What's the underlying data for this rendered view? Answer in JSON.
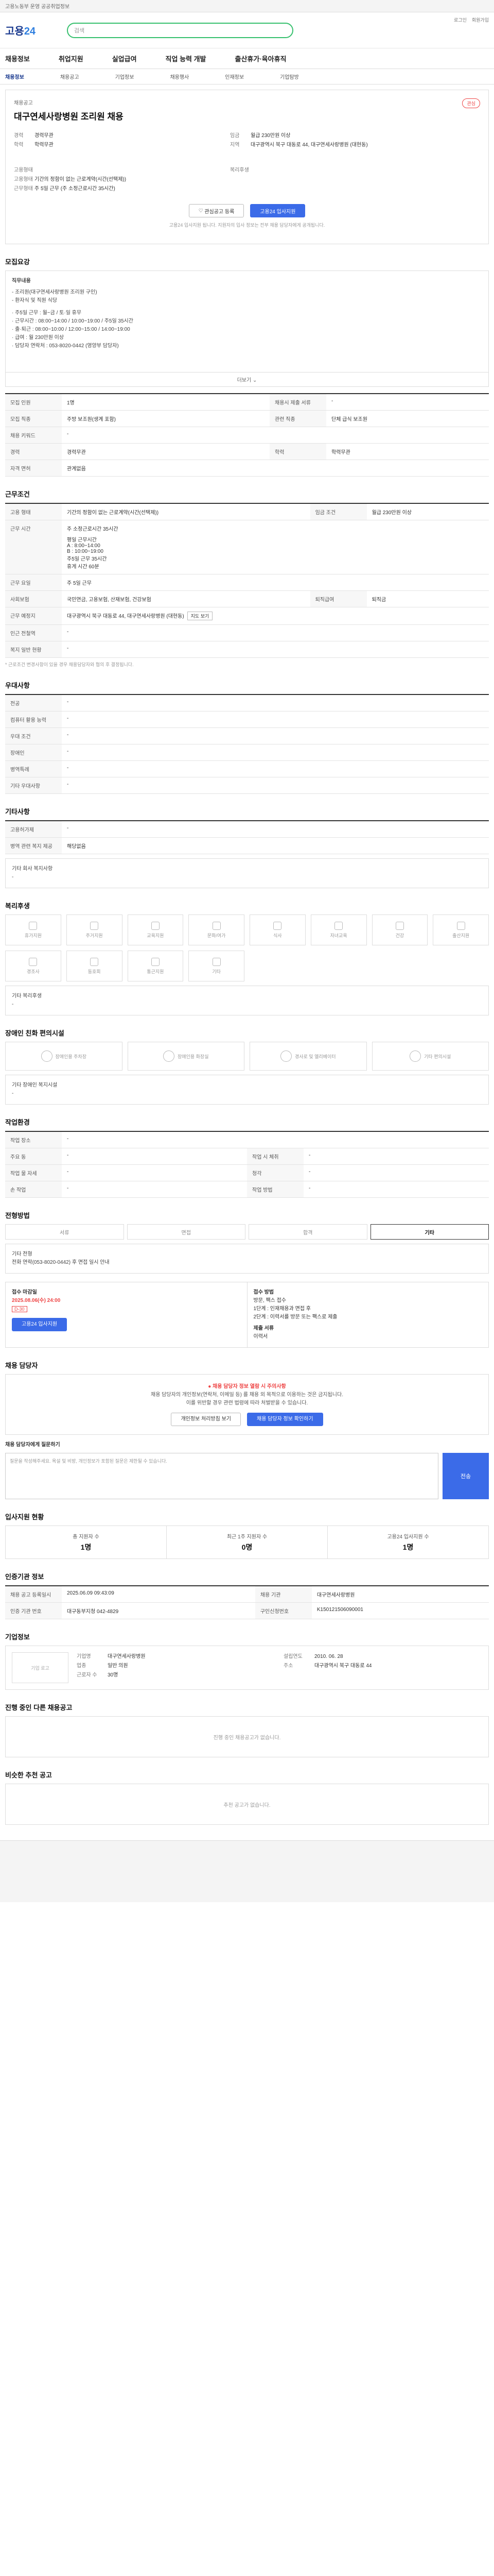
{
  "topbar": {
    "text": "고용노동부 운영 공공취업정보"
  },
  "header": {
    "logo_main": "고용",
    "logo_sub": "24",
    "search_placeholder": "검색",
    "links": [
      "로그인",
      "회원가입"
    ]
  },
  "gnb": [
    "채용정보",
    "취업지원",
    "실업급여",
    "직업 능력 개발",
    "출산휴가·육아휴직"
  ],
  "lnb": [
    "채용정보",
    "채용공고",
    "기업정보",
    "채용행사",
    "인재정보",
    "기업탐방"
  ],
  "hero": {
    "tag": "채용공고",
    "title": "대구연세사랑병원 조리원 채용",
    "star": "관심",
    "left": [
      {
        "k": "경력",
        "v": "경력무관"
      },
      {
        "k": "학력",
        "v": "학력무관"
      }
    ],
    "right": [
      {
        "k": "임금",
        "v": "월급 230만원 이상"
      },
      {
        "k": "지역",
        "v": "대구광역시 북구 대동로 44, 대구연세사랑병원 (대현동)"
      }
    ],
    "left2_label": "고용형태",
    "left2": [
      {
        "k": "고용형태",
        "v": "기간의 정함이 없는 근로계약(시간(선택제))"
      },
      {
        "k": "근무형태",
        "v": "주 5일 근무 (주 소정근로시간 35시간)"
      }
    ],
    "right2_label": "복리후생",
    "btn_save": "관심공고 등록",
    "btn_apply": "고용24 입사지원",
    "note": "고용24 입사지원 됩니다. 지원자의 입사 정보는 전부 채용 담당자에게 공개됩니다."
  },
  "sections": {
    "recruit": {
      "title": "모집요강",
      "body_label": "직무내용",
      "body": [
        "- 조리원(대구연세사랑병원 조리원 구인)",
        "- 환자식 및 직원 식당",
        "",
        "· 주5일 근무 : 월~금 / 토·일 휴무",
        "· 근무시간 : 08:00~14:00 / 10:00~19:00 / 주5일 35시간",
        "· 출·퇴근 : 08:00~10:00 / 12:00~15:00 / 14:00~19:00",
        "· 급여 : 월 230만원 이상",
        "· 담당자 연락처 : 053-8020-0442 (영양부 담당자)"
      ],
      "more": "더보기",
      "rows": [
        [
          "모집 인원",
          "1명",
          "채용시 제출 서류",
          "-"
        ],
        [
          "모집 직종",
          "주방 보조원(생계 포함)",
          "관련 직종",
          "단체 급식 보조원"
        ],
        [
          "채용 키워드",
          "-",
          "",
          ""
        ],
        [
          "경력",
          "경력무관",
          "학력",
          "학력무관"
        ],
        [
          "자격 면허",
          "관계없음",
          "",
          ""
        ]
      ]
    },
    "conditions": {
      "title": "근무조건",
      "rows": [
        [
          "고용 형태",
          "기간의 정함이 없는 근로계약(시간(선택제))",
          "임금 조건",
          "월급 230만원 이상"
        ],
        [
          "근무 시간",
          "주 소정근로시간 35시간",
          "",
          ""
        ],
        [
          "근무 요일",
          "주 5일 근무",
          "",
          ""
        ],
        [
          "사회보험",
          "국민연금, 고용보험, 산재보험, 건강보험",
          "퇴직급여",
          "퇴직금"
        ],
        [
          "근무 예정지",
          "대구광역시 북구 대동로 44, 대구연세사랑병원 (대현동)",
          "",
          ""
        ],
        [
          "인근 전철역",
          "-",
          "",
          ""
        ],
        [
          "복지 일반 현황",
          "-",
          "",
          ""
        ]
      ],
      "time_detail": [
        "평일 근무시간",
        "A : 8:00~14:00",
        "B : 10:00~19:00",
        "주5일 근무 35시간",
        "휴게 시간 60분"
      ],
      "map_btn": "지도 보기",
      "footnote": "* 근로조건 변경사항이 있을 경우 채용담당자와 협의 후 결정됩니다."
    },
    "priority": {
      "title": "우대사항",
      "rows": [
        [
          "전공",
          "-"
        ],
        [
          "컴퓨터 활용 능력",
          "-"
        ],
        [
          "우대 조건",
          "-"
        ],
        [
          "장애인",
          "-"
        ],
        [
          "병역특례",
          "-"
        ],
        [
          "기타 우대사항",
          "-"
        ]
      ]
    },
    "other": {
      "title": "기타사항",
      "rows": [
        [
          "고용허가제",
          "-"
        ],
        [
          "병역 관련 복지 제공",
          "해당없음"
        ]
      ],
      "extra_label": "기타 회사 복지사항",
      "extra": "-"
    },
    "welfare": {
      "title": "복리후생",
      "items": [
        "휴가지원",
        "주거지원",
        "교육지원",
        "문화/여가",
        "식사",
        "자녀교육",
        "건강",
        "출산지원",
        "경조사",
        "동호회",
        "통근지원",
        "기타"
      ],
      "extra_label": "기타 복리후생",
      "extra": "-"
    },
    "barrier": {
      "title": "장애인 친화 편의시설",
      "items": [
        "장애인용 주차장",
        "장애인용 화장실",
        "경사로 및 엘리베이터",
        "기타 편의시설"
      ],
      "extra_label": "기타 장애인 복지시설",
      "extra": "-"
    },
    "workenv": {
      "title": "작업환경",
      "rows": [
        [
          "작업 장소",
          "-",
          "",
          ""
        ],
        [
          "주요 동",
          "-",
          "작업 시 체취",
          "-"
        ],
        [
          "작업 물 자세",
          "-",
          "청각",
          "-"
        ],
        [
          "손 작업",
          "-",
          "작업 방법",
          "-"
        ]
      ]
    },
    "process": {
      "title": "전형방법",
      "steps": [
        "서류",
        "면접",
        "합격",
        "기타"
      ],
      "method_label": "기타 전형",
      "method": "전화 연락(053-8020-0442) 후 면접 일시 안내"
    },
    "deadline": {
      "left_title": "접수 마감일",
      "left_date": "2025.08.06(수) 24:00",
      "left_badge": "D-30",
      "apply_btn": "고용24 입사지원",
      "right_title": "접수 방법",
      "right_lines": [
        "방문, 팩스 접수",
        "1단계 : 인재채용과 면접 후",
        "2단계 : 이력서를 방문 또는 팩스로 제출"
      ],
      "right_title2": "제출 서류",
      "right_line2": "이력서"
    },
    "contact": {
      "title": "채용 담당자",
      "warn": "● 채용 담당자 정보 열람 시 주의사항",
      "lines": [
        "채용 담당자의 개인정보(연락처, 이메일 등) 를 채용 외 목적으로 이용하는 것은 금지됩니다.",
        "이를 위반할 경우 관련 법령에 따라 처벌받을 수 있습니다."
      ],
      "btn1": "개인정보 처리방침 보기",
      "btn2": "채용 담당자 정보 확인하기",
      "inquiry_label": "채용 담당자에게 질문하기",
      "inquiry_placeholder": "질문을 작성해주세요. 욕설 및 비방, 개인정보가 포함된 질문은 제한될 수 있습니다.",
      "send": "전송"
    },
    "applicants": {
      "title": "입사지원 현황",
      "items": [
        {
          "label": "총 지원자 수",
          "value": "1명"
        },
        {
          "label": "최근 1주 지원자 수",
          "value": "0명"
        },
        {
          "label": "고용24 입사지원 수",
          "value": "1명"
        }
      ]
    },
    "info": {
      "title": "인증기관 정보",
      "rows": [
        [
          "채용 공고 등록일시",
          "2025.06.09 09:43:09",
          "채용 기관",
          "대구연세사랑병원"
        ],
        [
          "인증 기관 번호",
          "대구동부지청 042-4829",
          "구인신청번호",
          "K150121506090001"
        ]
      ]
    },
    "companyinfo": {
      "title": "기업정보",
      "logo": "기업 로고",
      "name_label": "기업명",
      "name": "대구연세사랑병원",
      "type_label": "업종",
      "type": "일반 의원",
      "size_label": "근로자 수",
      "size": "30명",
      "founded_label": "설립연도",
      "founded": "2010. 06. 28",
      "addr_label": "주소",
      "addr": "대구광역시 북구 대동로 44"
    },
    "related": {
      "title": "진행 중인 다른 채용공고",
      "empty": "진행 중인 채용공고가 없습니다."
    },
    "similar": {
      "title": "비슷한 추천 공고",
      "empty": "추천 공고가 없습니다."
    }
  }
}
